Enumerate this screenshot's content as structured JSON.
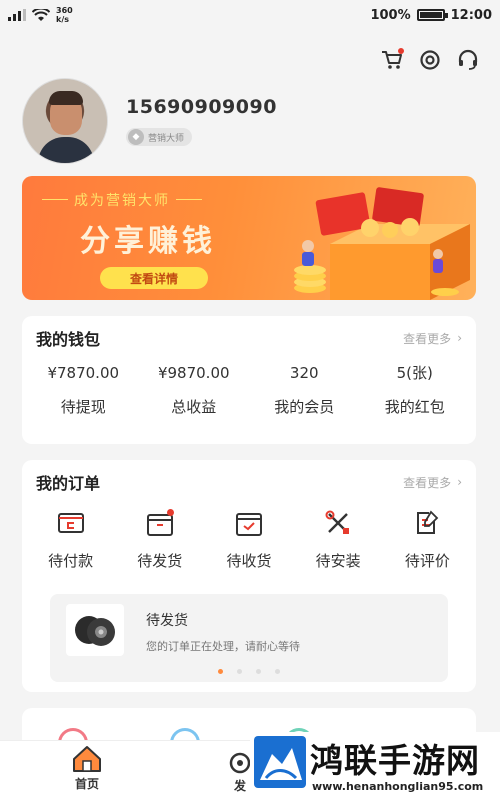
{
  "status_bar": {
    "netspeed": "360\nk/s",
    "netspeed_top": "360",
    "netspeed_bottom": "k/s",
    "battery": "100%",
    "time": "12:00"
  },
  "header_icons": [
    "cart-icon",
    "settings-icon",
    "headset-icon"
  ],
  "profile": {
    "phone": "15690909090",
    "badge": "营销大师"
  },
  "banner": {
    "subtitle": "成为营销大师",
    "title": "分享赚钱",
    "button": "查看详情"
  },
  "wallet": {
    "title": "我的钱包",
    "more": "查看更多",
    "items": [
      {
        "value": "¥7870.00",
        "label": "待提现"
      },
      {
        "value": "¥9870.00",
        "label": "总收益"
      },
      {
        "value": "320",
        "label": "我的会员"
      },
      {
        "value": "5(张)",
        "label": "我的红包"
      }
    ]
  },
  "orders": {
    "title": "我的订单",
    "more": "查看更多",
    "items": [
      {
        "label": "待付款",
        "icon": "payment-icon"
      },
      {
        "label": "待发货",
        "icon": "shipping-box-icon"
      },
      {
        "label": "待收货",
        "icon": "receive-box-icon"
      },
      {
        "label": "待安装",
        "icon": "tools-icon"
      },
      {
        "label": "待评价",
        "icon": "review-icon"
      }
    ],
    "notice": {
      "title": "待发货",
      "text": "您的订单正在处理，请耐心等待"
    }
  },
  "tabbar": {
    "home": "首页",
    "publish": "发"
  },
  "watermark": {
    "title": "鸿联手游网",
    "url": "www.henanhonglian95.com"
  },
  "colors": {
    "accent": "#ff8a3d",
    "banner_start": "#ff7a3d",
    "banner_end": "#ffb15a",
    "button_yellow": "#ffe14d"
  }
}
